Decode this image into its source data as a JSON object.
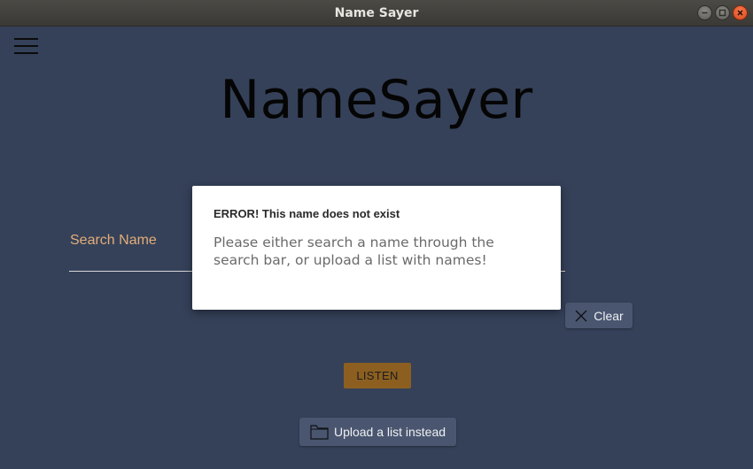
{
  "window": {
    "title": "Name Sayer"
  },
  "app": {
    "title": "NameSayer"
  },
  "search": {
    "label": "Search Name",
    "value": ""
  },
  "buttons": {
    "clear": "Clear",
    "listen": "LISTEN",
    "upload": "Upload a list instead"
  },
  "dialog": {
    "title": "ERROR! This name does not exist",
    "message": "Please either search a name through the search bar, or upload a list with names!"
  },
  "colors": {
    "background": "#354159",
    "accent_label": "#e3ad78",
    "listen_button": "#8c5f21",
    "secondary_button": "#4a566f"
  },
  "icons": {
    "menu": "hamburger-menu-icon",
    "clear": "close-icon",
    "upload": "folder-icon"
  }
}
